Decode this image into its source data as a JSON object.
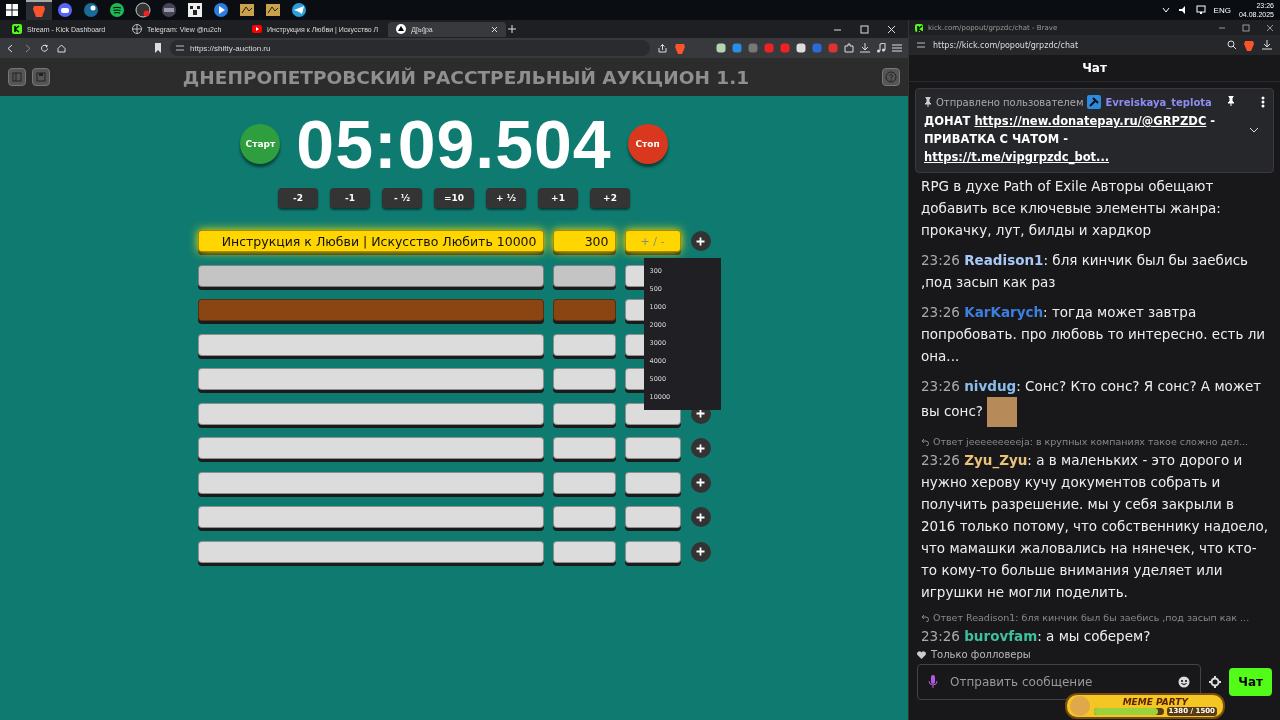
{
  "taskbar": {
    "apps": [
      {
        "kind": "brave",
        "selected": true
      },
      {
        "kind": "discord",
        "selected": false
      },
      {
        "kind": "steam",
        "selected": false
      },
      {
        "kind": "spotify",
        "selected": false
      },
      {
        "kind": "record",
        "selected": false
      },
      {
        "kind": "disc",
        "selected": false
      },
      {
        "kind": "pixel",
        "selected": false
      },
      {
        "kind": "play",
        "selected": false
      },
      {
        "kind": "game",
        "selected": false
      },
      {
        "kind": "game",
        "selected": false
      },
      {
        "kind": "telegram",
        "selected": false
      }
    ],
    "language": "ENG",
    "time": "23:26",
    "date": "04.08.2025"
  },
  "browser": {
    "tabs": [
      {
        "label": "Stream - Kick Dashboard",
        "kind": "kick",
        "selected": false
      },
      {
        "label": "Telegram: View @ru2ch",
        "kind": "globe",
        "selected": false
      },
      {
        "label": "Инструкция к Любви | Искусство Л",
        "kind": "youtube",
        "selected": false
      },
      {
        "label": "Д[ы]ра",
        "kind": "site",
        "selected": true
      }
    ],
    "address": "https://shitty-auction.ru"
  },
  "auction": {
    "title": "ДНЕПРОПЕТРОВСКИЙ РАССТРЕЛЬНЫЙ АУКЦИОН 1.1",
    "start_button": "Старт",
    "timer": "05:09.504",
    "stop_button": "Стоп",
    "time_buttons": [
      "-2",
      "-1",
      "- ½",
      "=10",
      "+ ½",
      "+1",
      "+2"
    ],
    "lots": [
      {
        "name": "Инструкция к Любви | Искусство Любить 10000",
        "amount": "300",
        "adjust": "+ / -",
        "color": "#ffd600"
      },
      {
        "color": "#c4c4c4"
      },
      {
        "color": "#8b4513"
      },
      {
        "color": "#dcdcdc"
      },
      {
        "color": "#dcdcdc"
      },
      {
        "color": "#dcdcdc"
      },
      {
        "color": "#dcdcdc"
      },
      {
        "color": "#dcdcdc"
      },
      {
        "color": "#dcdcdc"
      },
      {
        "color": "#dcdcdc"
      }
    ],
    "amount_menu": [
      "300",
      "500",
      "1000",
      "2000",
      "3000",
      "4000",
      "5000",
      "10000"
    ]
  },
  "chat_window": {
    "title": "kick.com/popout/grpzdc/chat - Brave",
    "address": "https://kick.com/popout/grpzdc/chat",
    "header": "Чат",
    "pinned": {
      "sent_by": "Отправлено пользователем",
      "user": "Evreiskaya_teplota",
      "parts": [
        {
          "kind": "text",
          "text": "ДОНАТ "
        },
        {
          "kind": "link",
          "text": "https://new.donatepay.ru/@GRPZDC"
        },
        {
          "kind": "text",
          "text": " - ПРИВАТКА С ЧАТОМ - "
        },
        {
          "kind": "link",
          "text": "https://t.me/vipgrpzdc_bot..."
        }
      ]
    },
    "messages": [
      {
        "text": "RPG в духе Path of Exile Авторы обещают добавить все ключевые элементы жанра: прокачку, лут, билды и хардкор"
      },
      {
        "time": "23:26",
        "user": "Readison1",
        "color": "#a9c9f5",
        "separator": ":",
        "text": "бля кинчик был бы заебись ,под засып как раз"
      },
      {
        "time": "23:26",
        "user": "KarKarych",
        "color": "#3d7fe0",
        "separator": ":",
        "text": "тогда может завтра попробовать. про любовь то интересно. есть ли она..."
      },
      {
        "time": "23:26",
        "user": "nivdug",
        "color": "#8cbcec",
        "separator": ":",
        "text": "Сонс? Кто сонс? Я сонс? А может вы сонс?",
        "emote": true
      },
      {
        "reply": "Ответ jeeeeeeeeeja: в крупных компаниях такое сложно дел...",
        "time": "23:26",
        "user": "Zyu_Zyu",
        "color": "#e8c27a",
        "separator": ":",
        "text": "а в маленьких - это дорого и нужно херову кучу документов собрать и получить разрешение. мы у себя закрыли в 2016 только потому, что собственнику надоело, что мамашки жаловались на нянечек, что кто-то кому-то больше внимания уделяет или игрушки не могли поделить."
      },
      {
        "reply": "Ответ Readison1: бля кинчик был бы заебись ,под засып как ...",
        "time": "23:26",
        "user": "burovfam",
        "color": "#3fbfa0",
        "separator": ":",
        "text": "а мы соберем?"
      }
    ],
    "mode": "Только фолловеры",
    "placeholder": "Отправить сообщение",
    "send_button": "Чат",
    "widget": {
      "title": "MEME PARTY",
      "progress": "1380 / 1500",
      "level": 0.92
    }
  }
}
